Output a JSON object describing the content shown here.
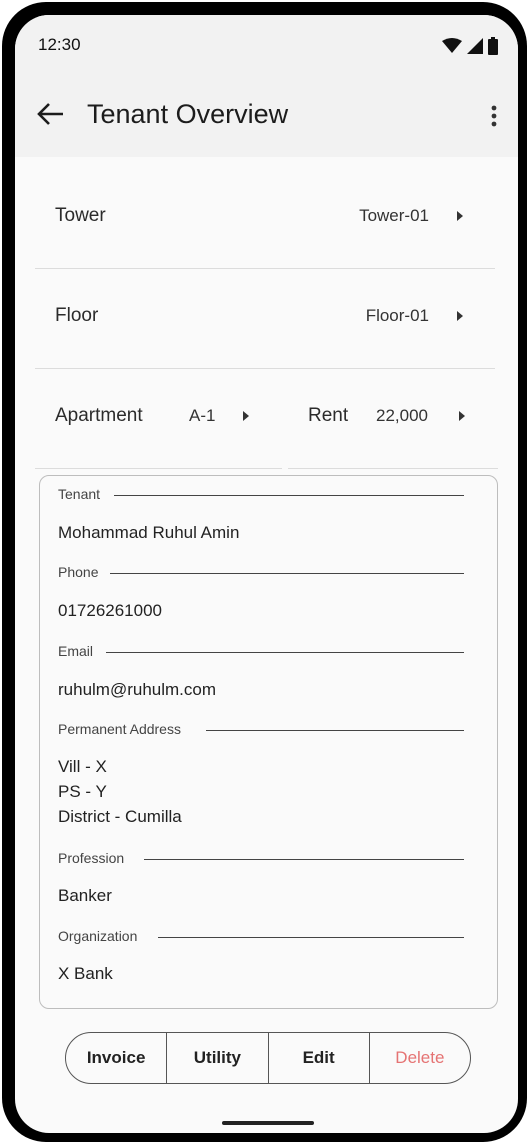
{
  "status": {
    "time": "12:30"
  },
  "appbar": {
    "title": "Tenant Overview"
  },
  "tower": {
    "label": "Tower",
    "value": "Tower-01"
  },
  "floor": {
    "label": "Floor",
    "value": "Floor-01"
  },
  "apartment": {
    "label": "Apartment",
    "value": "A-1"
  },
  "rent": {
    "label": "Rent",
    "value": "22,000"
  },
  "details": {
    "tenant_label": "Tenant",
    "tenant": "Mohammad Ruhul Amin",
    "phone_label": "Phone",
    "phone": "01726261000",
    "email_label": "Email",
    "email": "ruhulm@ruhulm.com",
    "address_label": "Permanent Address",
    "address_line1": "Vill - X",
    "address_line2": "PS - Y",
    "address_line3": "District - Cumilla",
    "profession_label": "Profession",
    "profession": "Banker",
    "organization_label": "Organization",
    "organization": "X Bank"
  },
  "actions": {
    "invoice": "Invoice",
    "utility": "Utility",
    "edit": "Edit",
    "delete": "Delete"
  },
  "colors": {
    "delete": "#e57373",
    "appbar_bg": "#f2f2f2"
  },
  "icons": [
    "back-arrow-icon",
    "more-vert-icon",
    "chevron-right-icon",
    "wifi-icon",
    "signal-icon",
    "battery-icon"
  ]
}
